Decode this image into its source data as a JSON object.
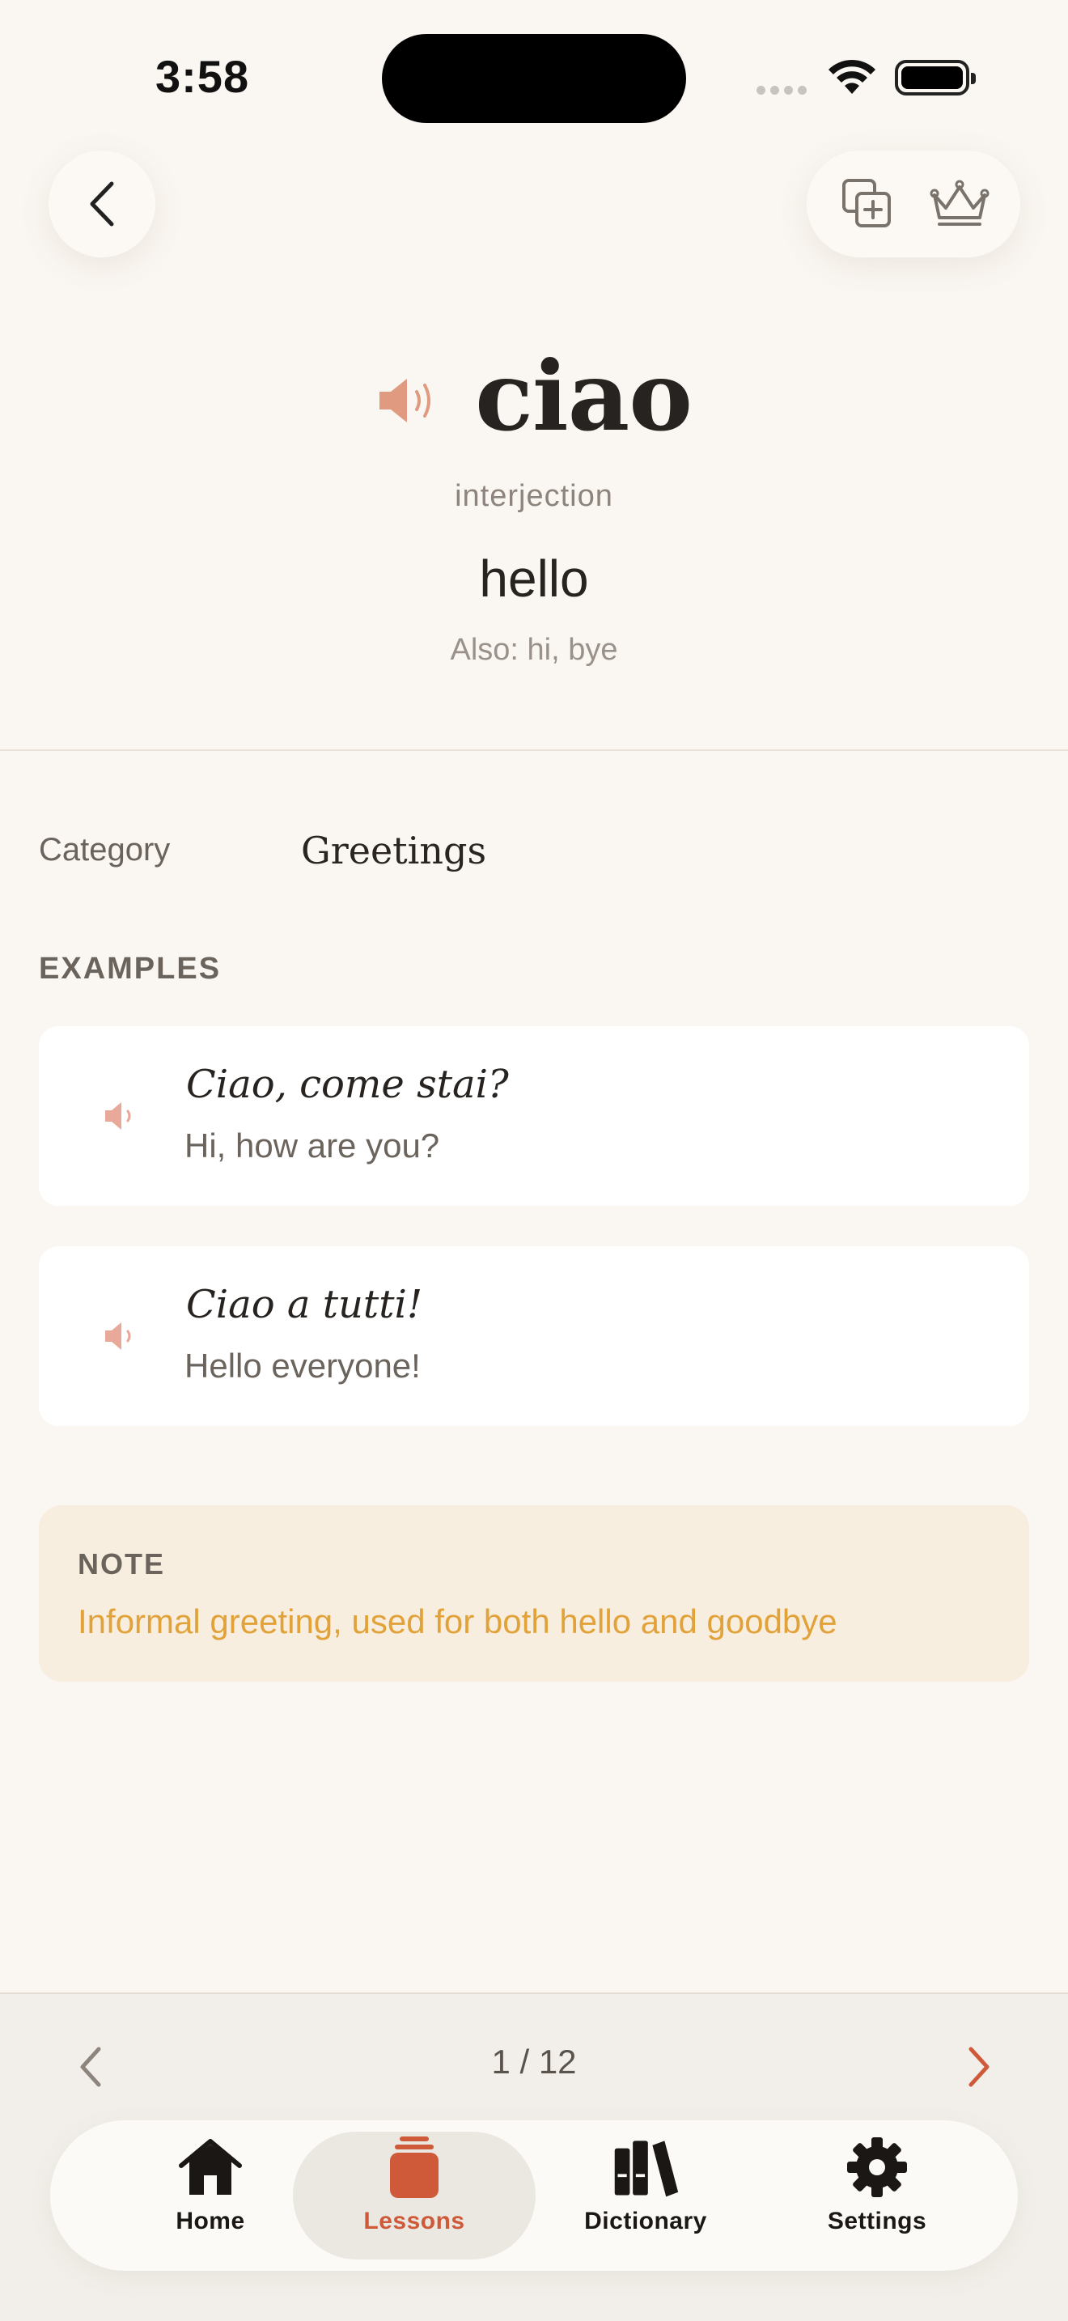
{
  "status": {
    "time": "3:58"
  },
  "word": {
    "text": "ciao",
    "part_of_speech": "interjection",
    "translation": "hello",
    "also": "Also: hi, bye"
  },
  "category": {
    "label": "Category",
    "value": "Greetings"
  },
  "examples": {
    "title": "EXAMPLES",
    "items": [
      {
        "italian": "Ciao, come stai?",
        "english": "Hi, how are you?"
      },
      {
        "italian": "Ciao a tutti!",
        "english": "Hello everyone!"
      }
    ]
  },
  "note": {
    "label": "NOTE",
    "text": "Informal greeting, used for both hello and goodbye"
  },
  "pager": {
    "count": "1 / 12"
  },
  "tabs": [
    {
      "label": "Home",
      "icon": "home-icon"
    },
    {
      "label": "Lessons",
      "icon": "lessons-icon",
      "active": true
    },
    {
      "label": "Dictionary",
      "icon": "dictionary-icon"
    },
    {
      "label": "Settings",
      "icon": "gear-icon"
    }
  ],
  "colors": {
    "accent": "#cf5a3a",
    "speaker": "#e09a80",
    "note_text": "#e2a23a",
    "note_bg": "#f8eedf",
    "background": "#faf6f1"
  }
}
